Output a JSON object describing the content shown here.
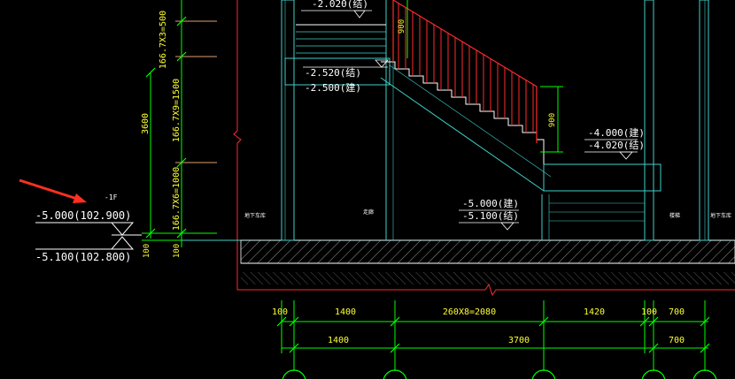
{
  "drawing": {
    "colors": {
      "background": "#000000",
      "dimension_green": "#00ff00",
      "structure_cyan": "#3fd0c8",
      "railing_red": "#ff2a2a",
      "label_white": "#ffffff",
      "dim_yellow": "#ffff33",
      "pointer_red": "#ff3020",
      "ext_orange": "#e0a070"
    },
    "floor_label": "-1F",
    "elev_left_top": "-5.000(102.900)",
    "elev_left_bottom": "-5.100(102.800)",
    "elev_top": "-2.020(结)",
    "elev_landing_1": "-2.520(结)",
    "elev_landing_2": "-2.500(建)",
    "elev_right_1": "-4.000(建)",
    "elev_right_2": "-4.020(结)",
    "elev_bottom_1": "-5.000(建)",
    "elev_bottom_2": "-5.100(结)",
    "vertical_dims": {
      "total": "3600",
      "seg_top": "166.7X3=500",
      "seg_mid": "166.7X9=1500",
      "seg_low": "166.7X6=1000",
      "base_1": "100",
      "base_2": "100"
    },
    "rail_dims": {
      "upper": "900",
      "lower": "900"
    },
    "room_labels": {
      "left": "地下车库",
      "middle": "走廊",
      "right_1": "楼梯",
      "right_2": "地下车库"
    },
    "horizontal_dims_row1": [
      "100",
      "1400",
      "260X8=2080",
      "1420",
      "100",
      "700"
    ],
    "horizontal_dims_row2": [
      "1400",
      "3700",
      "700"
    ]
  }
}
